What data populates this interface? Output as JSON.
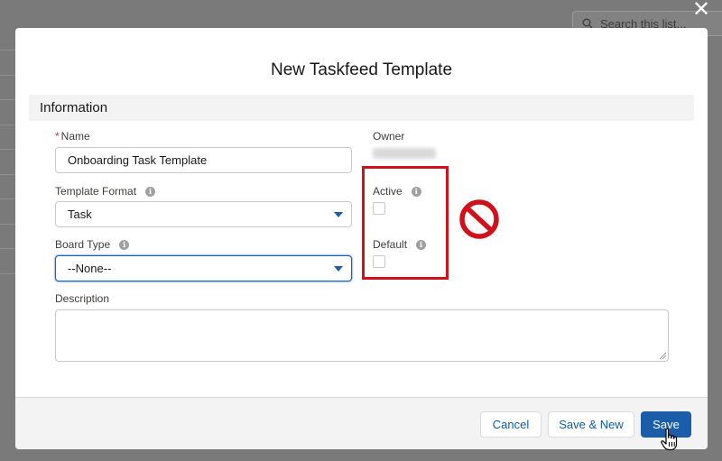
{
  "background": {
    "search_placeholder": "Search this list..."
  },
  "modal": {
    "title": "New Taskfeed Template",
    "section_title": "Information",
    "fields": {
      "name": {
        "label": "Name",
        "required_marker": "*",
        "value": "Onboarding Task Template"
      },
      "owner": {
        "label": "Owner"
      },
      "template_format": {
        "label": "Template Format",
        "value": "Task"
      },
      "board_type": {
        "label": "Board Type",
        "value": "--None--"
      },
      "active": {
        "label": "Active",
        "checked": false
      },
      "default": {
        "label": "Default",
        "checked": false
      },
      "description": {
        "label": "Description",
        "value": ""
      }
    },
    "buttons": {
      "cancel": "Cancel",
      "save_new": "Save & New",
      "save": "Save"
    }
  },
  "colors": {
    "brand": "#1b5da8",
    "highlight_box": "#d0101a",
    "required": "#c23934"
  },
  "icons": [
    "close-icon",
    "search-icon",
    "info-icon",
    "chevron-down-icon",
    "prohibited-icon",
    "hand-pointer-icon"
  ]
}
